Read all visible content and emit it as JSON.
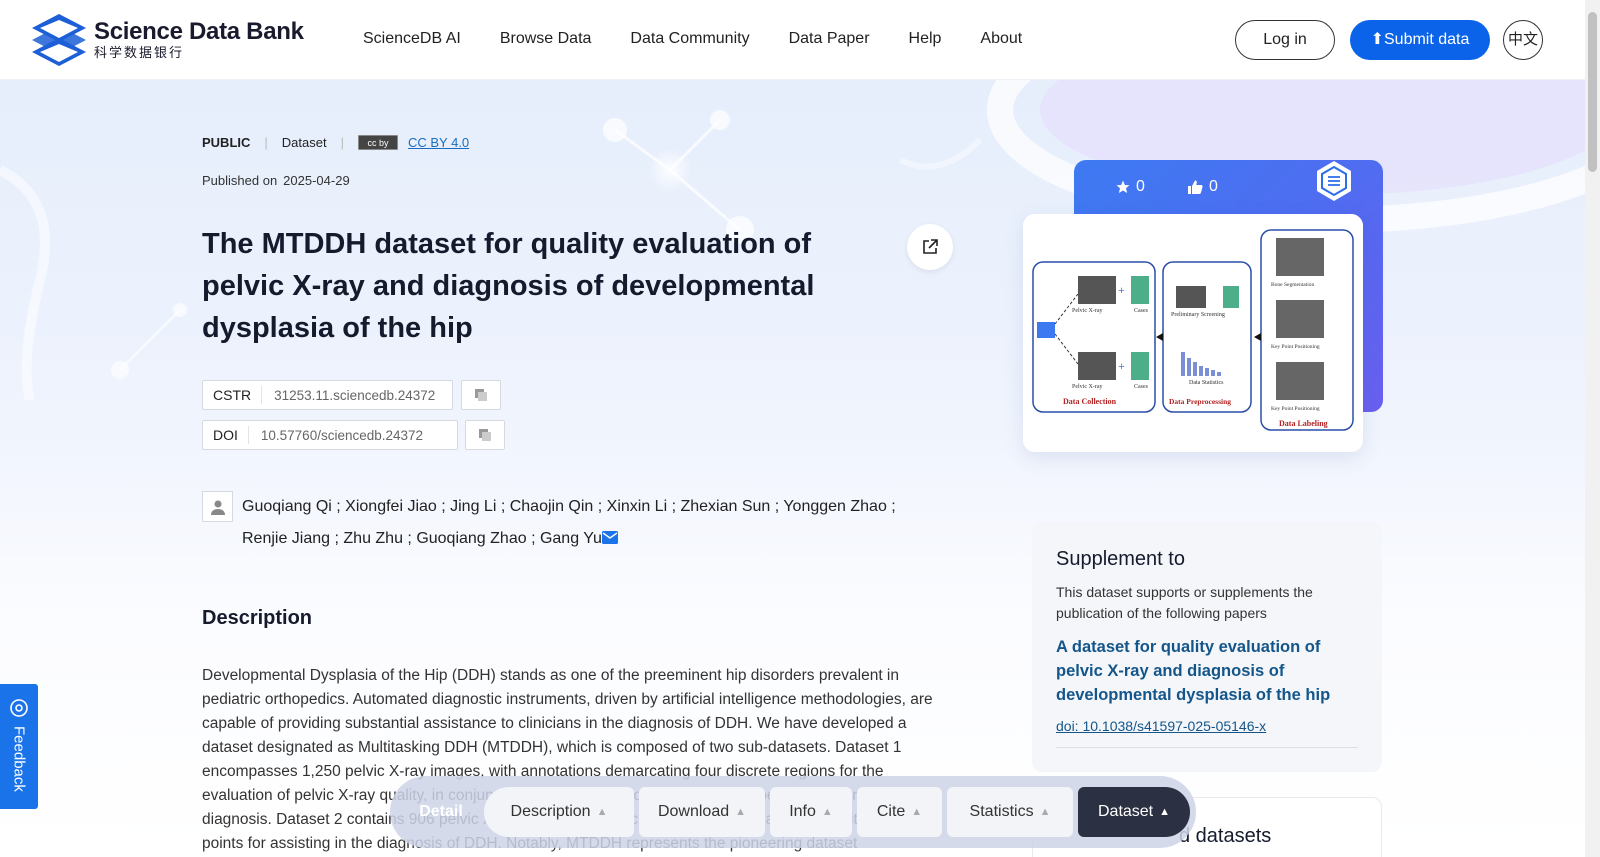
{
  "header": {
    "logo_en": "Science Data Bank",
    "logo_cn": "科学数据银行",
    "nav": [
      "ScienceDB AI",
      "Browse Data",
      "Data Community",
      "Data Paper",
      "Help",
      "About"
    ],
    "login_label": "Log in",
    "submit_label": "Submit data",
    "lang_label": "中文"
  },
  "meta": {
    "visibility": "PUBLIC",
    "type": "Dataset",
    "license_badge": "cc by",
    "license": "CC BY 4.0",
    "published_label": "Published on",
    "published_date": "2025-04-29"
  },
  "title": "The MTDDH dataset for quality evaluation of pelvic X-ray and diagnosis of developmental dysplasia of the hip",
  "identifiers": {
    "cstr_label": "CSTR",
    "cstr_value": "31253.11.sciencedb.24372",
    "doi_label": "DOI",
    "doi_value": "10.57760/sciencedb.24372"
  },
  "authors": "Guoqiang Qi ; Xiongfei Jiao ; Jing Li ; Chaojin Qin ; Xinxin Li ; Zhexian Sun ; Yonggen Zhao ; Renjie Jiang ; Zhu Zhu ; Guoqiang Zhao ; Gang Yu",
  "description": {
    "heading": "Description",
    "text": "Developmental Dysplasia of the Hip (DDH) stands as one of the preeminent hip disorders prevalent in pediatric orthopedics. Automated diagnostic instruments, driven by artificial intelligence methodologies, are capable of providing substantial assistance to clinicians in the diagnosis of DDH. We have developed a dataset designated as Multitasking DDH (MTDDH), which is composed of two sub-datasets. Dataset 1 encompasses 1,250 pelvic X-ray images, with annotations demarcating four discrete regions for the evaluation of pelvic X-ray quality, in conjunction with eight keypoints serving as a benchmark for DDH diagnosis. Dataset 2 contains 906 pelvic X-ray images, and each image has been annotated with eight key points for assisting in the diagnosis of DDH. Notably, MTDDH represents the pioneering dataset"
  },
  "stats": {
    "stars": "0",
    "likes": "0"
  },
  "figure": {
    "labels": [
      "Pelvic X-ray",
      "Cases",
      "Pelvic X-ray",
      "Cases",
      "Data Collection",
      "Preliminary Screening",
      "Data Statistics",
      "Data Preprocessing",
      "Bone Segmentation",
      "Key Point Positioning",
      "Key Point Positioning",
      "Data Labeling"
    ]
  },
  "supplement": {
    "title": "Supplement to",
    "text": "This dataset supports or supplements the publication of the following papers",
    "paper_title": "A dataset for quality evaluation of pelvic X-ray and diagnosis of developmental dysplasia of the hip",
    "paper_doi": "doi: 10.1038/s41597-025-05146-x"
  },
  "related": {
    "title": "d datasets"
  },
  "feedback_label": "Feedback",
  "bottom_bar": {
    "detail": "Detail",
    "tabs": [
      "Description",
      "Download",
      "Info",
      "Cite",
      "Statistics",
      "Dataset"
    ]
  },
  "colors": {
    "primary": "#0a63e8",
    "link": "#14568a",
    "dark_tab": "#2b3142"
  }
}
